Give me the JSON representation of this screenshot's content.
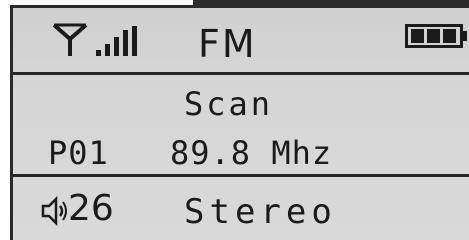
{
  "header": {
    "mode": "FM",
    "antenna_icon": "antenna-icon",
    "signal_icon": "signal-bars-icon",
    "signal_bars": 4,
    "battery_icon": "battery-icon",
    "battery_level": 0.75
  },
  "main": {
    "status": "Scan",
    "preset": "P01",
    "frequency": "89.8 Mhz"
  },
  "footer": {
    "speaker_icon": "speaker-icon",
    "volume": "26",
    "audio_mode": "Stereo"
  },
  "colors": {
    "lcd_background": "#d4d4d4",
    "lcd_foreground": "#1b1b1b"
  }
}
